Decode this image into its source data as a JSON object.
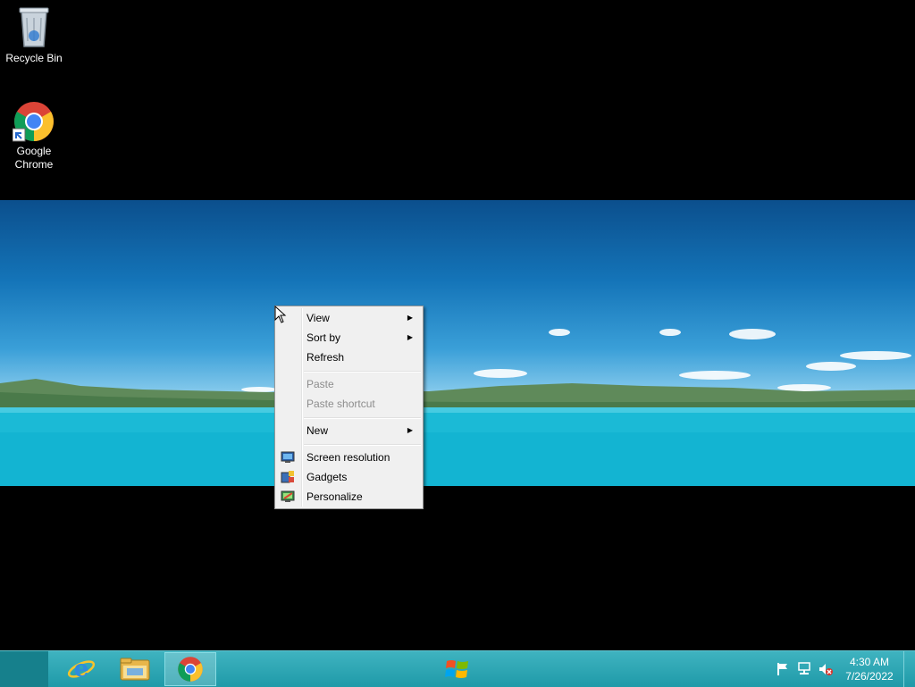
{
  "desktop": {
    "icons": [
      {
        "label": "Recycle Bin",
        "icon": "recycle-bin-icon"
      },
      {
        "label": "Google\nChrome",
        "icon": "chrome-icon"
      }
    ]
  },
  "context_menu": {
    "items": [
      {
        "label": "View",
        "has_submenu": true,
        "enabled": true
      },
      {
        "label": "Sort by",
        "has_submenu": true,
        "enabled": true
      },
      {
        "label": "Refresh",
        "has_submenu": false,
        "enabled": true
      },
      {
        "label": "Paste",
        "has_submenu": false,
        "enabled": false
      },
      {
        "label": "Paste shortcut",
        "has_submenu": false,
        "enabled": false
      },
      {
        "label": "New",
        "has_submenu": true,
        "enabled": true
      },
      {
        "label": "Screen resolution",
        "icon": "monitor-icon",
        "enabled": true
      },
      {
        "label": "Gadgets",
        "icon": "gadgets-icon",
        "enabled": true
      },
      {
        "label": "Personalize",
        "icon": "personalize-icon",
        "enabled": true
      }
    ],
    "submenu_arrow": "▶"
  },
  "taskbar": {
    "pinned": [
      {
        "name": "start",
        "icon": "windows-logo-icon"
      },
      {
        "name": "internet-explorer",
        "icon": "internet-explorer-icon"
      },
      {
        "name": "file-explorer",
        "icon": "folder-icon"
      },
      {
        "name": "chrome",
        "icon": "chrome-icon",
        "active": true
      }
    ],
    "tray": [
      "flag-icon",
      "network-icon",
      "volume-muted-icon"
    ],
    "clock": {
      "time": "4:30 AM",
      "date": "7/26/2022"
    }
  },
  "colors": {
    "taskbar": "#1f9aa8",
    "menu_bg": "#f0f0f0",
    "accent": "#3fb3c0"
  }
}
